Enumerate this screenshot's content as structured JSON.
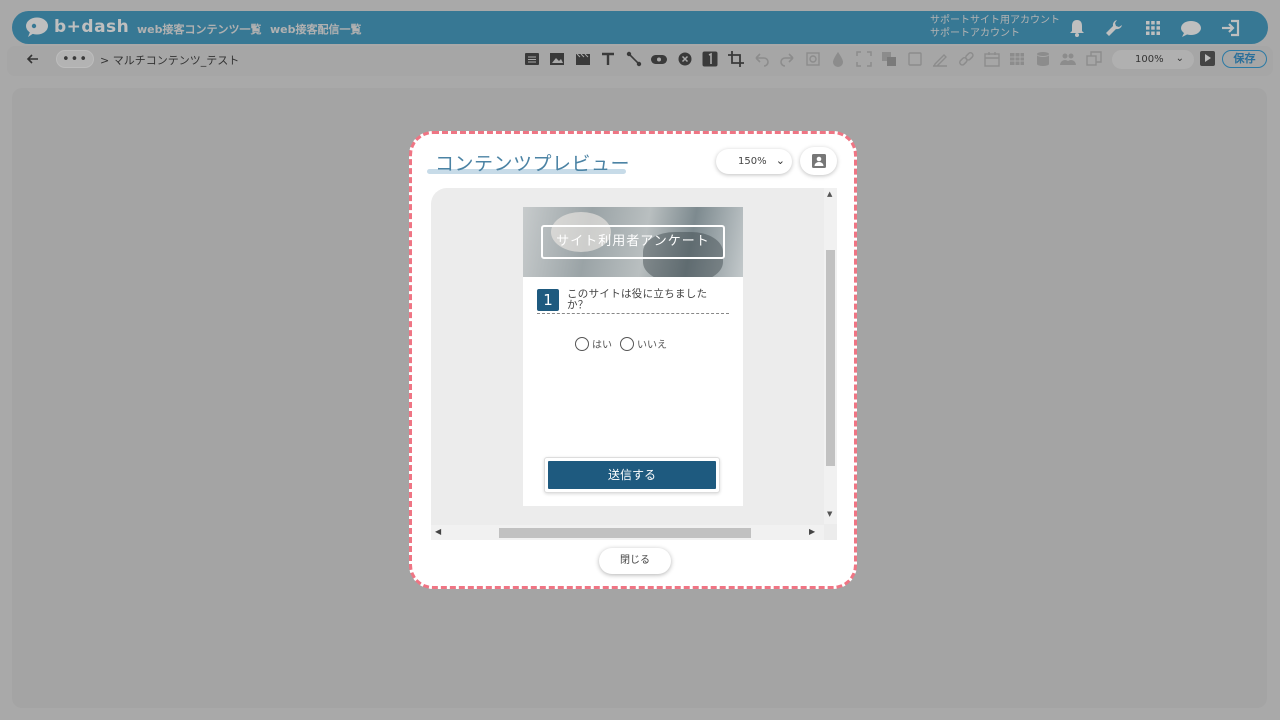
{
  "app": {
    "logo_text": "b+dash",
    "nav": [
      "web接客コンテンツ一覧",
      "web接客配信一覧"
    ],
    "account_line1": "サポートサイト用アカウント",
    "account_line2": "サポートアカウント",
    "top_icons": [
      "bell-icon",
      "wrench-icon",
      "grid-icon",
      "cloud-icon",
      "logout-icon"
    ]
  },
  "toolbar": {
    "more_label": "•••",
    "breadcrumb": "> マルチコンテンツ_テスト",
    "tools": [
      "list-icon",
      "image-icon",
      "video-icon",
      "text-icon",
      "connector-icon",
      "badge-icon",
      "close-circle-icon",
      "number-icon",
      "crop-icon",
      "undo-icon",
      "redo-icon",
      "frame-icon",
      "drop-icon",
      "fullscreen-icon",
      "layers-icon",
      "square-icon",
      "pen-icon",
      "link-icon",
      "calendar-icon",
      "table-icon",
      "database-icon",
      "users-icon",
      "copy-icon"
    ],
    "zoom": "100%",
    "save_label": "保存"
  },
  "modal": {
    "title": "コンテンツプレビュー",
    "zoom": "150%",
    "close_label": "閉じる"
  },
  "survey": {
    "header": "サイト利用者アンケート",
    "question_number": "1",
    "question_text": "このサイトは役に立ちましたか？",
    "options": [
      "はい",
      "いいえ"
    ],
    "submit_label": "送信する"
  },
  "colors": {
    "header_blue": "#4aa0c6",
    "modal_border": "#ef7584",
    "survey_primary": "#1e5a7f"
  }
}
